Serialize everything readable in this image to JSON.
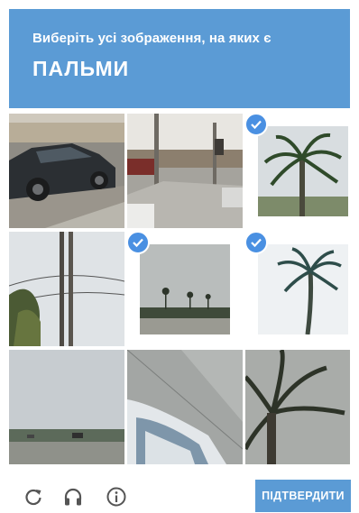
{
  "header": {
    "instruction": "Виберіть  усі зображення, на яких є",
    "target_word": "ПАЛЬМИ"
  },
  "grid": {
    "tiles": [
      {
        "id": 1,
        "content": "car-on-road",
        "selected": false
      },
      {
        "id": 2,
        "content": "street-intersection",
        "selected": false
      },
      {
        "id": 3,
        "content": "palm-tree",
        "selected": true
      },
      {
        "id": 4,
        "content": "tree-trunks-and-wires",
        "selected": false
      },
      {
        "id": 5,
        "content": "distant-palms-horizon",
        "selected": true
      },
      {
        "id": 6,
        "content": "tall-palm-tree",
        "selected": true
      },
      {
        "id": 7,
        "content": "coastline-road",
        "selected": false
      },
      {
        "id": 8,
        "content": "car-roof-and-sidewalk",
        "selected": false
      },
      {
        "id": 9,
        "content": "palm-fronds",
        "selected": false
      }
    ]
  },
  "footer": {
    "icons": [
      "reload-icon",
      "headphones-icon",
      "info-icon"
    ],
    "verify_label": "ПІДТВЕРДИТИ"
  },
  "colors": {
    "accent": "#5b9bd5",
    "checkmark": "#4a90e2"
  }
}
